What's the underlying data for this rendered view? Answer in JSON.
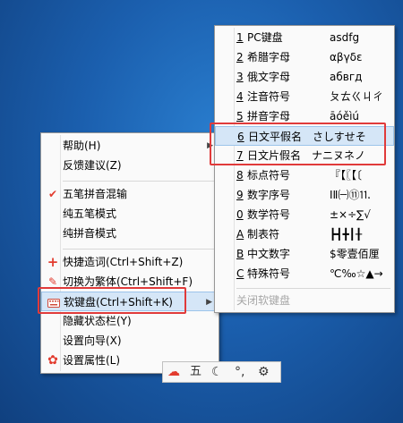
{
  "main_menu": {
    "items": [
      {
        "label": "帮助(H)",
        "has_submenu": true
      },
      {
        "label": "反馈建议(Z)"
      },
      {
        "label": "五笔拼音混输",
        "checked": true
      },
      {
        "label": "纯五笔模式"
      },
      {
        "label": "纯拼音模式"
      },
      {
        "label": "快捷造词(Ctrl+Shift+Z)",
        "icon": "plus-icon"
      },
      {
        "label": "切换为繁体(Ctrl+Shift+F)",
        "icon": "pen-icon"
      },
      {
        "label": "软键盘(Ctrl+Shift+K)",
        "icon": "keyboard-icon",
        "has_submenu": true,
        "highlighted": true
      },
      {
        "label": "隐藏状态栏(Y)"
      },
      {
        "label": "设置向导(X)"
      },
      {
        "label": "设置属性(L)",
        "icon": "gear-icon"
      }
    ]
  },
  "soft_keyboard_menu": {
    "items": [
      {
        "num": "1",
        "name": "PC键盘",
        "sample": "asdfg"
      },
      {
        "num": "2",
        "name": "希腊字母",
        "sample": "αβγδε"
      },
      {
        "num": "3",
        "name": "俄文字母",
        "sample": "абвгд"
      },
      {
        "num": "4",
        "name": "注音符号",
        "sample": "ㄆㄊㄍㄐㄔ"
      },
      {
        "num": "5",
        "name": "拼音字母",
        "sample": "āóěìú"
      },
      {
        "num": "6",
        "name": "日文平假名",
        "sample": "さしすせそ",
        "highlighted": true
      },
      {
        "num": "7",
        "name": "日文片假名",
        "sample": "ナニヌネノ"
      },
      {
        "num": "8",
        "name": "标点符号",
        "sample": "『【〖【〔"
      },
      {
        "num": "9",
        "name": "数字序号",
        "sample": "ⅠⅡ㈠⑪⒒"
      },
      {
        "num": "0",
        "name": "数学符号",
        "sample": "±×÷∑√"
      },
      {
        "num": "A",
        "name": "制表符",
        "sample": "┣┫╋┃╂"
      },
      {
        "num": "B",
        "name": "中文数字",
        "sample": "$零壹佰厘"
      },
      {
        "num": "C",
        "name": "特殊符号",
        "sample": "℃‰☆▲→"
      }
    ],
    "close_label": "关闭软键盘"
  },
  "ime_bar": {
    "items": [
      "pinyin-logo-icon",
      "wubi-icon",
      "moon-icon",
      "punctuation-icon",
      "gear-icon"
    ],
    "wubi_label": "五"
  },
  "colors": {
    "highlight_box": "#e03a3a",
    "accent_red": "#e23b2e",
    "menu_bg": "#fafafa",
    "selection_bg": "#d5e6f7"
  }
}
